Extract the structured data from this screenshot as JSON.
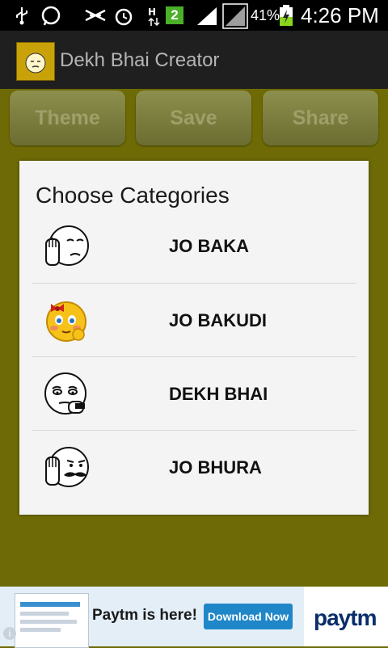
{
  "status": {
    "battery_percent": "41%",
    "time": "4:26 PM",
    "sim_badge": "2",
    "icons": [
      "usb-icon",
      "whatsapp-icon",
      "mute-icon",
      "alarm-icon",
      "data-icon",
      "sim-icon",
      "signal-icon",
      "signal-icon",
      "battery-icon"
    ]
  },
  "app": {
    "title": "Dekh Bhai Creator",
    "logo_icon": "app-logo-icon"
  },
  "toolbar": {
    "theme_label": "Theme",
    "save_label": "Save",
    "share_label": "Share"
  },
  "dialog": {
    "title": "Choose Categories",
    "items": [
      {
        "label": "JO BAKA",
        "icon": "face-palm-icon"
      },
      {
        "label": "JO BAKUDI",
        "icon": "blushing-girl-emoji-icon"
      },
      {
        "label": "DEKH BHAI",
        "icon": "sleepy-face-icon"
      },
      {
        "label": "JO BHURA",
        "icon": "mustache-face-icon"
      }
    ]
  },
  "ad": {
    "text": "Paytm is here!",
    "button_label": "Download Now",
    "brand": "paytm",
    "info": "i"
  },
  "colors": {
    "background": "#6e6a05",
    "actionbar": "#1f1f1f",
    "dialog": "#f4f4f4"
  }
}
